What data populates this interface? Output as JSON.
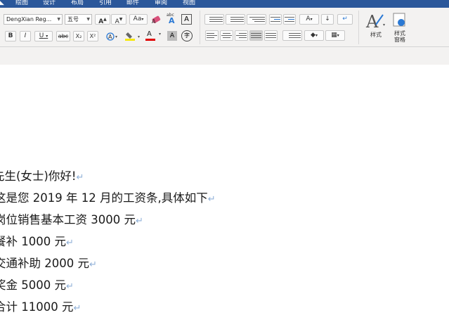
{
  "menu_tabs": [
    "绘图",
    "设计",
    "布局",
    "引用",
    "邮件",
    "审阅",
    "视图"
  ],
  "font": {
    "name": "DengXian Reg...",
    "size": "五号"
  },
  "format_buttons": {
    "bold": "B",
    "italic": "I",
    "underline": "U",
    "strike": "abc",
    "subscript": "X₂",
    "superscript": "X²"
  },
  "font_color_label": "A",
  "phonetic_label": "字",
  "abc_label": "abc",
  "styles_label": "样式",
  "styles_pane_label": "样式\n窗格",
  "colors": {
    "ribbon_tab_bg": "#2b579a",
    "highlight": "#f5e80a",
    "font_color": "#e00000",
    "paragraph_mark": "#8fb0d8"
  },
  "document": {
    "lines": [
      "先生(女士)你好!",
      "这是您 2019 年 12 月的工资条,具体如下",
      "岗位销售基本工资 3000 元",
      "餐补 1000 元",
      "交通补助 2000 元",
      "奖金 5000 元",
      "合计 11000 元"
    ],
    "paragraph_mark": "↵"
  }
}
